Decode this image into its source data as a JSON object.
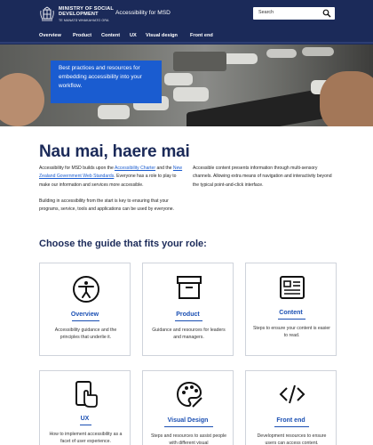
{
  "header": {
    "ministry_line1": "MINISTRY OF SOCIAL",
    "ministry_line2": "DEVELOPMENT",
    "ministry_maori": "TE MANATŪ WHAKAHIATO ORA",
    "site_title": "Accessibility for MSD",
    "search_placeholder": "Search"
  },
  "nav": {
    "items": [
      "Overview",
      "Product",
      "Content",
      "UX",
      "Visual design",
      "Front end"
    ]
  },
  "hero": {
    "callout": "Best practices and resources for embedding accessibility into your workflow."
  },
  "intro": {
    "heading": "Nau mai, haere mai",
    "p1_pre": "Accessibility for MSD builds upon the ",
    "p1_link1": "Accessibility Charter",
    "p1_mid": " and the ",
    "p1_link2": "New Zealand Government Web Standards",
    "p1_post": ". Everyone has a role to play to make our information and services more accessible.",
    "p2": "Building in accessibility from the start is key to ensuring that your programs, service, tools and applications can be used by everyone.",
    "p3": "Accessible content presents information through multi-sensory channels. Allowing extra means of navigation and interactivity beyond the typical point-and-click interface."
  },
  "guides": {
    "heading": "Choose the guide that fits your role:",
    "cards": [
      {
        "title": "Overview",
        "icon": "accessibility-person-icon",
        "desc": "Accessibility guidance and the principles that underlie it."
      },
      {
        "title": "Product",
        "icon": "archive-box-icon",
        "desc": "Guidance and resources for leaders and managers."
      },
      {
        "title": "Content",
        "icon": "document-layout-icon",
        "desc": "Steps to ensure your content is easier to read."
      },
      {
        "title": "UX",
        "icon": "tap-hand-phone-icon",
        "desc": "How to implement accessibility as a facet of user experience."
      },
      {
        "title": "Visual Design",
        "icon": "palette-icon",
        "desc": "Steps and resources to assist people with different visual"
      },
      {
        "title": "Front end",
        "icon": "code-brackets-icon",
        "desc": "Development resources to ensure users can access content."
      }
    ]
  },
  "colors": {
    "header_bg": "#1b2a59",
    "accent_blue": "#1a5cd0",
    "link_blue": "#1a4fb3"
  }
}
